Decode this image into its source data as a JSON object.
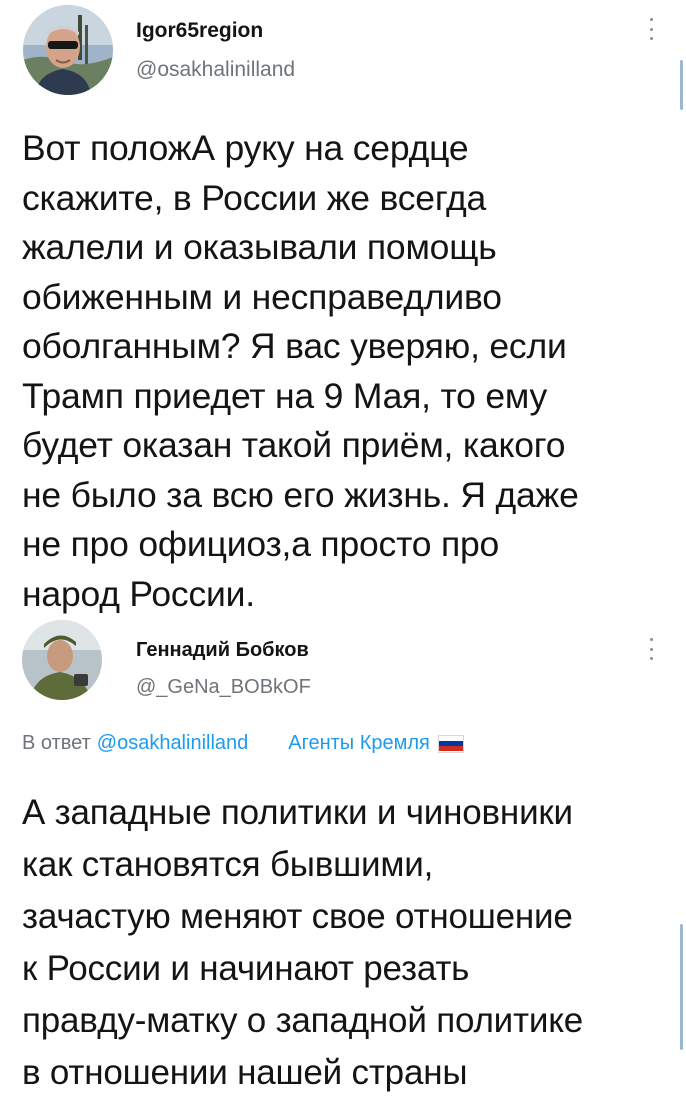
{
  "tweet1": {
    "display_name": "Igor65region",
    "handle": "@osakhalinilland",
    "text": "Вот положА руку на сердце\nскажите, в России же всегда\nжалели и оказывали помощь\nобиженным и несправедливо\nоболганным? Я вас уверяю, если\nТрамп приедет на 9 Мая, то ему\nбудет оказан такой приём, какого\nне было за всю его жизнь. Я даже\nне про официоз,а просто про\nнарод России.",
    "avatar_icon": "user-avatar-photo",
    "more_icon": "vertical-dots-icon"
  },
  "tweet2": {
    "display_name": "Геннадий Бобков",
    "handle": "@_GeNa_BOBkOF",
    "reply_prefix": "В ответ",
    "reply_to": "@osakhalinilland",
    "tag": "Агенты Кремля",
    "flag_colors": [
      "#ffffff",
      "#0039a6",
      "#d52b1e"
    ],
    "text": "А западные политики и чиновники\nкак становятся бывшими,\nзачастую меняют свое отношение\nк России и начинают резать\nправду-матку о западной политике\nв отношении нашей страны",
    "avatar_icon": "user-avatar-photo",
    "more_icon": "vertical-dots-icon"
  },
  "colors": {
    "link": "#1d9bf0",
    "secondary_text": "#6e7479",
    "primary_text": "#141414"
  }
}
